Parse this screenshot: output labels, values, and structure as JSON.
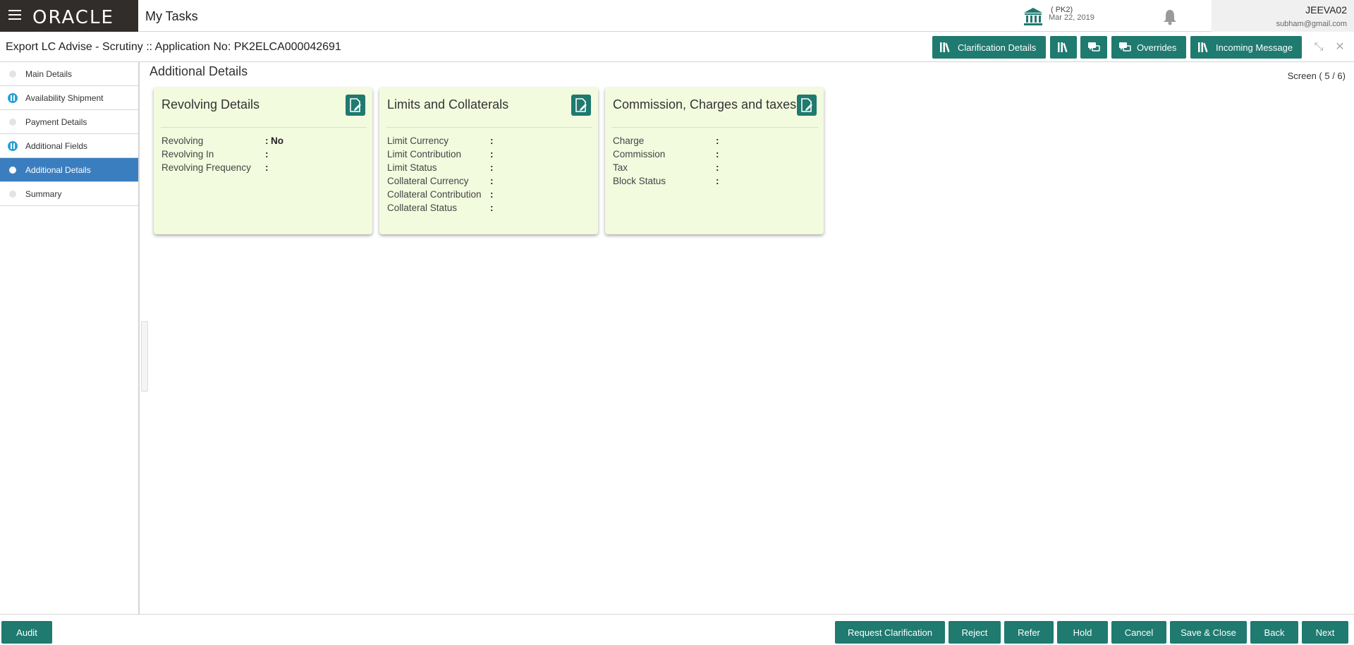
{
  "topbar": {
    "brand": "ORACLE",
    "app_name": "My Tasks",
    "branch_code": "( PK2)",
    "branch_date": "Mar 22, 2019",
    "user_name": "JEEVA02",
    "user_email": "subham@gmail.com"
  },
  "subheader": {
    "title": "Export LC Advise - Scrutiny :: Application No: PK2ELCA000042691",
    "buttons": {
      "clarification": "Clarification Details",
      "overrides": "Overrides",
      "incoming": "Incoming Message"
    }
  },
  "sidebar": {
    "items": [
      {
        "label": "Main Details"
      },
      {
        "label": "Availability Shipment"
      },
      {
        "label": "Payment Details"
      },
      {
        "label": "Additional Fields"
      },
      {
        "label": "Additional Details"
      },
      {
        "label": "Summary"
      }
    ]
  },
  "main": {
    "title": "Additional Details",
    "screen_count": "Screen ( 5 / 6)",
    "cards": [
      {
        "title": "Revolving Details",
        "rows": [
          {
            "label": "Revolving",
            "sep": ":",
            "value": "No"
          },
          {
            "label": "Revolving In",
            "sep": ":",
            "value": ""
          },
          {
            "label": "Revolving Frequency",
            "sep": ":",
            "value": ""
          }
        ]
      },
      {
        "title": "Limits and Collaterals",
        "rows": [
          {
            "label": "Limit Currency",
            "sep": ":",
            "value": ""
          },
          {
            "label": "Limit Contribution",
            "sep": ":",
            "value": ""
          },
          {
            "label": "Limit Status",
            "sep": ":",
            "value": ""
          },
          {
            "label": "Collateral Currency",
            "sep": ":",
            "value": ""
          },
          {
            "label": "Collateral Contribution",
            "sep": ":",
            "value": ""
          },
          {
            "label": "Collateral Status",
            "sep": ":",
            "value": ""
          }
        ]
      },
      {
        "title": "Commission, Charges and taxes",
        "rows": [
          {
            "label": "Charge",
            "sep": ":",
            "value": ""
          },
          {
            "label": "Commission",
            "sep": ":",
            "value": ""
          },
          {
            "label": "Tax",
            "sep": ":",
            "value": ""
          },
          {
            "label": "Block Status",
            "sep": ":",
            "value": ""
          }
        ]
      }
    ]
  },
  "footer": {
    "audit": "Audit",
    "request_clarification": "Request Clarification",
    "reject": "Reject",
    "refer": "Refer",
    "hold": "Hold",
    "cancel": "Cancel",
    "save_close": "Save & Close",
    "back": "Back",
    "next": "Next"
  },
  "colors": {
    "accent": "#1f7a6f",
    "active_nav": "#3b7ec0",
    "card_bg": "#f3fbdf",
    "brand_bg": "#312d2a"
  }
}
